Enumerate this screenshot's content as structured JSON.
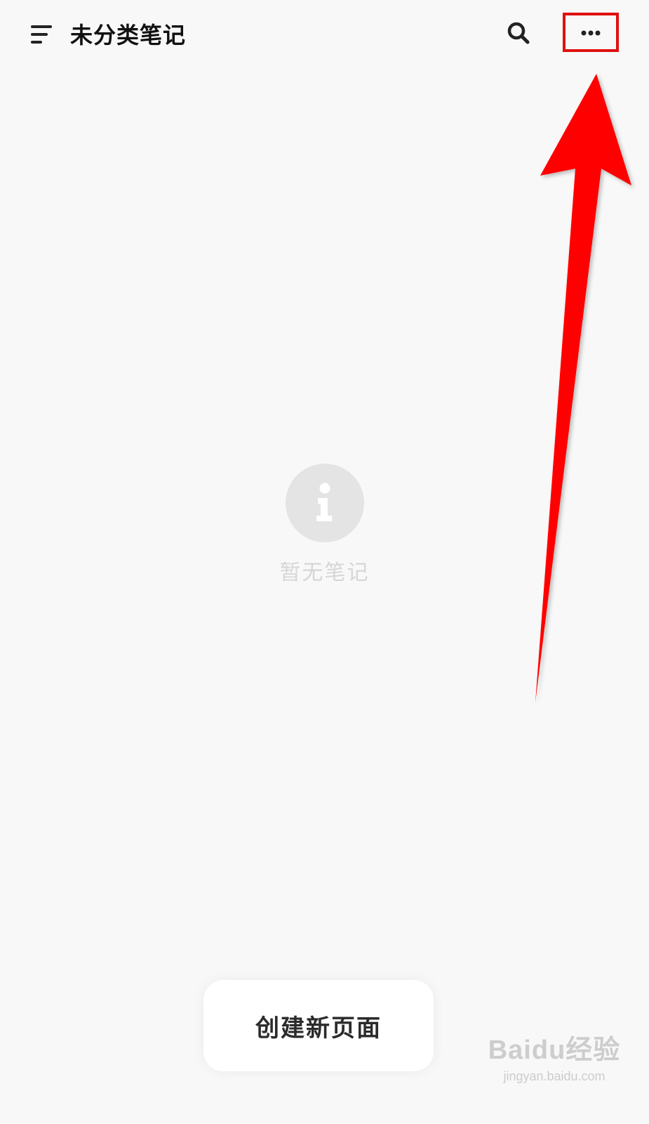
{
  "header": {
    "title": "未分类笔记",
    "menu_icon": "sort-menu-icon",
    "search_icon": "search-icon",
    "more_icon": "more-horizontal-icon"
  },
  "empty_state": {
    "icon": "info-icon",
    "message": "暂无笔记"
  },
  "actions": {
    "create_page_label": "创建新页面"
  },
  "annotation": {
    "type": "arrow-pointing-to-more-button",
    "color": "#ff0000"
  },
  "watermark": {
    "brand": "Baidu经验",
    "url": "jingyan.baidu.com"
  },
  "colors": {
    "background": "#f8f8f8",
    "text_primary": "#111111",
    "empty_text": "#d6d6d6",
    "empty_icon_bg": "#e4e4e4",
    "button_bg": "#ffffff"
  }
}
